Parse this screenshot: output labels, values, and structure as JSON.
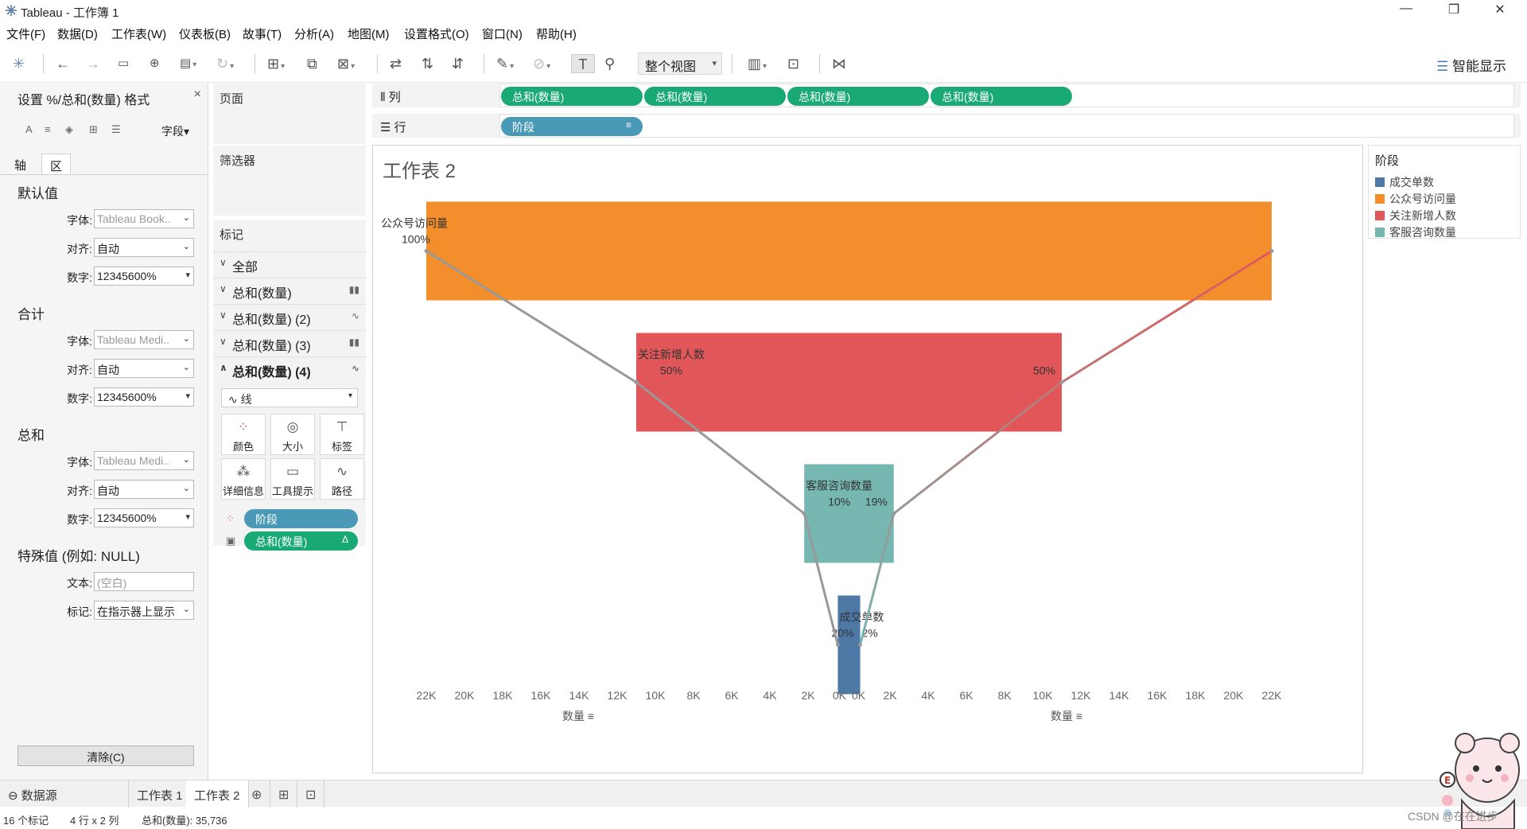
{
  "window": {
    "title": "Tableau - 工作簿 1",
    "min": "—",
    "max": "❐",
    "close": "✕"
  },
  "menu": [
    "文件(F)",
    "数据(D)",
    "工作表(W)",
    "仪表板(B)",
    "故事(T)",
    "分析(A)",
    "地图(M)",
    "设置格式(O)",
    "窗口(N)",
    "帮助(H)"
  ],
  "toolbar": {
    "view_mode": "整个视图",
    "smart_show": "智能显示"
  },
  "format_pane": {
    "title": "设置 %/总和(数量) 格式",
    "fields_dropdown": "字段",
    "tabs": [
      "轴",
      "区"
    ],
    "sections": [
      {
        "heading": "默认值",
        "font": "Tableau Book..",
        "align": "自动",
        "number": "12345600%"
      },
      {
        "heading": "合计",
        "font": "Tableau Medi..",
        "align": "自动",
        "number": "12345600%"
      },
      {
        "heading": "总和",
        "font": "Tableau Medi..",
        "align": "自动",
        "number": "12345600%"
      }
    ],
    "labels": {
      "font": "字体:",
      "align": "对齐:",
      "number": "数字:",
      "text": "文本:",
      "marks": "标记:"
    },
    "special": {
      "heading": "特殊值 (例如: NULL)",
      "text_placeholder": "(空白)",
      "marks_value": "在指示器上显示"
    },
    "clear_button": "清除(C)"
  },
  "cards": {
    "pages": "页面",
    "filters": "筛选器",
    "marks": "标记"
  },
  "marks_card": {
    "rows": [
      "全部",
      "总和(数量)",
      "总和(数量) (2)",
      "总和(数量) (3)",
      "总和(数量) (4)"
    ],
    "mark_type": "线",
    "buttons": [
      "颜色",
      "大小",
      "标签",
      "详细信息",
      "工具提示",
      "路径"
    ],
    "pills": [
      "阶段",
      "总和(数量)"
    ]
  },
  "shelves": {
    "columns_label": "列",
    "rows_label": "行",
    "column_pills": [
      "总和(数量)",
      "总和(数量)",
      "总和(数量)",
      "总和(数量)"
    ],
    "row_pills": [
      "阶段"
    ]
  },
  "sheet_title": "工作表 2",
  "legend": {
    "title": "阶段",
    "items": [
      {
        "label": "成交单数",
        "color": "#4e79a7"
      },
      {
        "label": "公众号访问量",
        "color": "#f28e2b"
      },
      {
        "label": "关注新增人数",
        "color": "#e15759"
      },
      {
        "label": "客服咨询数量",
        "color": "#76b7b2"
      }
    ]
  },
  "chart_data": {
    "type": "bar",
    "title": "工作表 2",
    "categories": [
      "公众号访问量",
      "关注新增人数",
      "客服咨询数量",
      "成交单数"
    ],
    "values": [
      22000,
      11000,
      2200,
      440
    ],
    "left_percent_labels": [
      "100%",
      "50%",
      "10%",
      "2%"
    ],
    "right_percent_labels": [
      "",
      "50%",
      "19%",
      "20%"
    ],
    "left_axis": {
      "ticks": [
        "22K",
        "20K",
        "18K",
        "16K",
        "14K",
        "12K",
        "10K",
        "8K",
        "6K",
        "4K",
        "2K",
        "0K"
      ],
      "title": "数量",
      "reversed": true,
      "range": [
        0,
        22000
      ]
    },
    "right_axis": {
      "ticks": [
        "0K",
        "2K",
        "4K",
        "6K",
        "8K",
        "10K",
        "12K",
        "14K",
        "16K",
        "18K",
        "20K",
        "22K"
      ],
      "title": "数量",
      "range": [
        0,
        22000
      ]
    },
    "grid": false,
    "lines": [
      {
        "name": "left",
        "color": "#999999",
        "values": [
          22000,
          11000,
          2200,
          440
        ]
      },
      {
        "name": "right",
        "color_start": "#e15759",
        "color_end": "#76b7b2",
        "values": [
          22000,
          11000,
          2200,
          440
        ]
      }
    ]
  },
  "bottom_tabs": {
    "datasource": "数据源",
    "sheets": [
      "工作表 1",
      "工作表 2"
    ],
    "active": "工作表 2"
  },
  "status": {
    "marks": "16 个标记",
    "dims": "4 行 x 2 列",
    "sum": "总和(数量): 35,736"
  },
  "watermark": "CSDN @在在进步"
}
